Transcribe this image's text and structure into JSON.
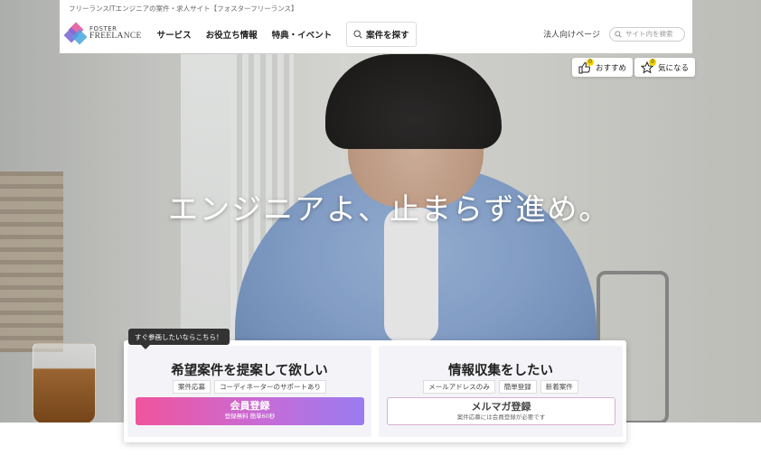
{
  "topline": "フリーランスITエンジニアの案件・求人サイト【フォスターフリーランス】",
  "logo": {
    "line1": "FOSTER",
    "line2": "FREELANCE"
  },
  "nav": {
    "items": [
      "サービス",
      "お役立ち情報",
      "特典・イベント"
    ],
    "search_button": "案件を探す",
    "corp_link": "法人向けページ",
    "site_search_placeholder": "サイト内を検索"
  },
  "pills": {
    "recommend": {
      "label": "おすすめ",
      "count": "0"
    },
    "favorite": {
      "label": "気になる",
      "count": "0"
    }
  },
  "hero": {
    "catchcopy": "エンジニアよ、止まらず進め。"
  },
  "bubble": "すぐ参画したいならこちら！",
  "cta": {
    "left": {
      "title": "希望案件を提案して欲しい",
      "tags": [
        "案件応募",
        "コーディネーターのサポートあり"
      ],
      "button_main": "会員登録",
      "button_sub": "登録無料 簡単60秒"
    },
    "right": {
      "title": "情報収集をしたい",
      "tags": [
        "メールアドレスのみ",
        "簡単登録",
        "新着案件"
      ],
      "button_main": "メルマガ登録",
      "button_sub": "案件応募には会員登録が必要です"
    }
  },
  "colors": {
    "accent_pink": "#f0549c",
    "accent_purple": "#9a7cf0",
    "badge_yellow": "#f7d400"
  }
}
